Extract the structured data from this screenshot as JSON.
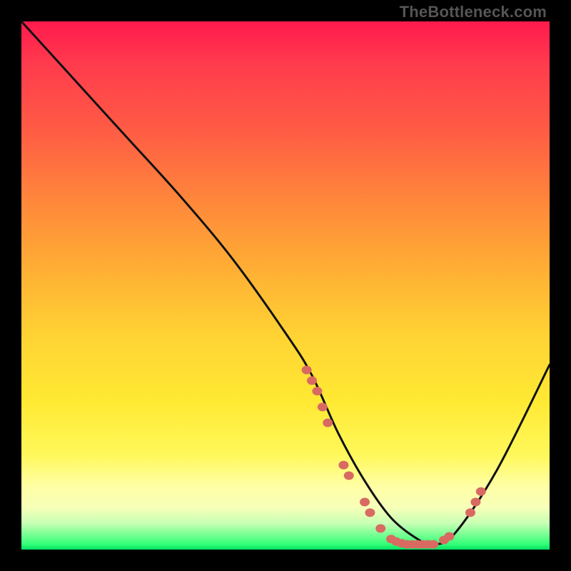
{
  "watermark": "TheBottleneck.com",
  "chart_data": {
    "type": "line",
    "title": "",
    "xlabel": "",
    "ylabel": "",
    "xlim": [
      0,
      100
    ],
    "ylim": [
      0,
      100
    ],
    "curve": {
      "name": "bottleneck-curve",
      "x": [
        0,
        10,
        20,
        30,
        40,
        50,
        55,
        60,
        65,
        70,
        75,
        78,
        82,
        90,
        100
      ],
      "y": [
        100,
        89,
        78,
        67,
        55,
        41,
        33,
        22,
        13,
        6,
        2,
        1,
        3,
        15,
        35
      ]
    },
    "markers": {
      "name": "highlight-points",
      "color": "#d96a62",
      "points": [
        {
          "x": 54,
          "y": 34
        },
        {
          "x": 55,
          "y": 32
        },
        {
          "x": 56,
          "y": 30
        },
        {
          "x": 57,
          "y": 27
        },
        {
          "x": 58,
          "y": 24
        },
        {
          "x": 61,
          "y": 16
        },
        {
          "x": 62,
          "y": 14
        },
        {
          "x": 65,
          "y": 9
        },
        {
          "x": 66,
          "y": 7
        },
        {
          "x": 68,
          "y": 4
        },
        {
          "x": 70,
          "y": 2
        },
        {
          "x": 71,
          "y": 1.5
        },
        {
          "x": 72,
          "y": 1.2
        },
        {
          "x": 73,
          "y": 1
        },
        {
          "x": 74,
          "y": 1
        },
        {
          "x": 75,
          "y": 1
        },
        {
          "x": 76,
          "y": 1
        },
        {
          "x": 77,
          "y": 1
        },
        {
          "x": 78,
          "y": 1
        },
        {
          "x": 80,
          "y": 1.8
        },
        {
          "x": 81,
          "y": 2.5
        },
        {
          "x": 85,
          "y": 7
        },
        {
          "x": 86,
          "y": 9
        },
        {
          "x": 87,
          "y": 11
        }
      ]
    }
  }
}
